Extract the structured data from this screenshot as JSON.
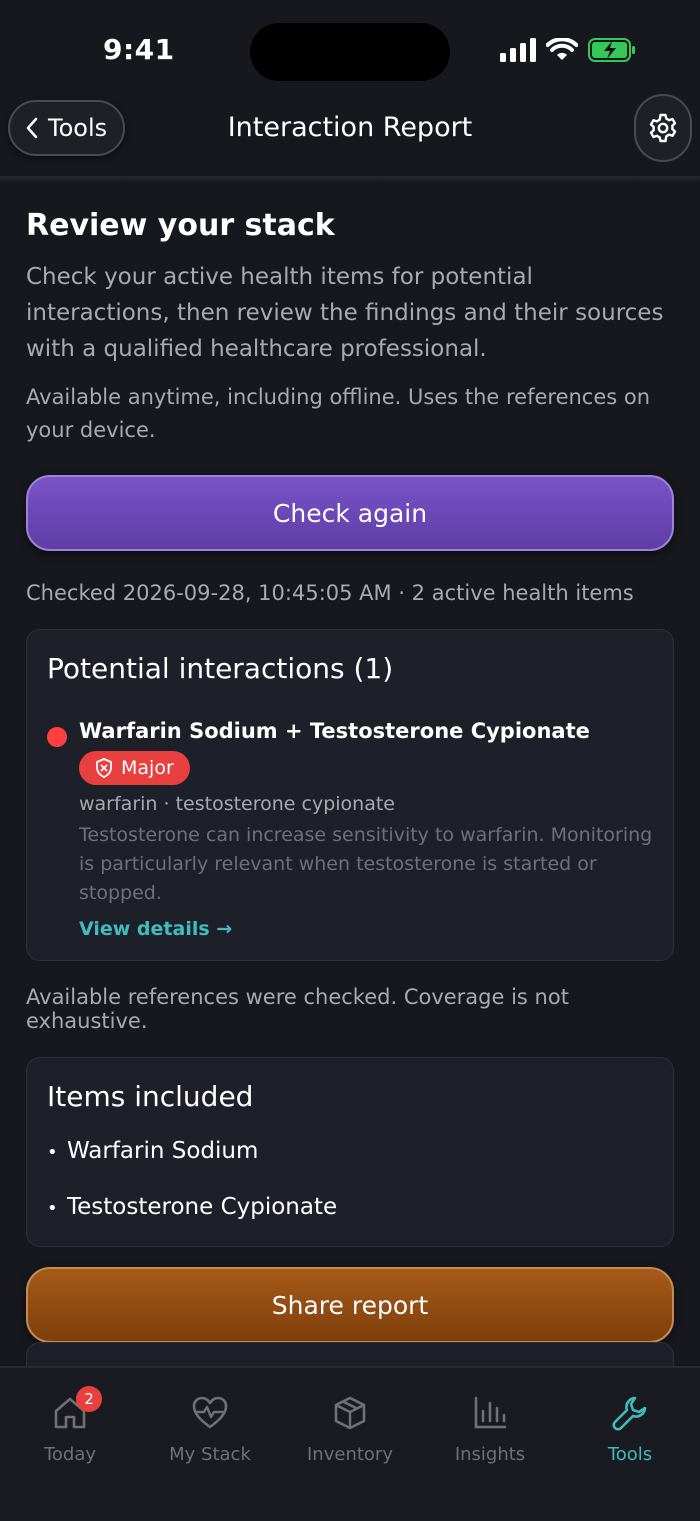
{
  "status": {
    "time": "9:41"
  },
  "nav": {
    "back_label": "Tools",
    "title": "Interaction Report"
  },
  "review": {
    "heading": "Review your stack",
    "intro": "Check your active health items for potential interactions, then review the findings and their sources with a qualified healthcare professional.",
    "note": "Available anytime, including offline. Uses the references on your device.",
    "check_button": "Check again",
    "checked_line": "Checked 2026-09-28, 10:45:05 AM · 2 active health items"
  },
  "interactions": {
    "title": "Potential interactions (1)",
    "items": [
      {
        "title": "Warfarin Sodium + Testosterone Cypionate",
        "severity": "Major",
        "severity_color": "#e8403f",
        "drugs": "warfarin · testosterone cypionate",
        "description": "Testosterone can increase sensitivity to warfarin. Monitoring is particularly relevant when testosterone is started or stopped.",
        "details_link": "View details →"
      }
    ]
  },
  "coverage_note": "Available references were checked. Coverage is not exhaustive.",
  "items_included": {
    "title": "Items included",
    "items": [
      "Warfarin Sodium",
      "Testosterone Cypionate"
    ]
  },
  "share_button": "Share report",
  "tabs": [
    {
      "label": "Today",
      "icon": "home-icon",
      "badge": "2"
    },
    {
      "label": "My Stack",
      "icon": "heart-pulse-icon"
    },
    {
      "label": "Inventory",
      "icon": "box-icon"
    },
    {
      "label": "Insights",
      "icon": "bar-chart-icon"
    },
    {
      "label": "Tools",
      "icon": "wrench-icon",
      "active": true
    }
  ],
  "colors": {
    "accent": "#3fbcc0",
    "primary_button": "#6a47b8",
    "share_button": "#93500f",
    "severity_major": "#e8403f"
  }
}
